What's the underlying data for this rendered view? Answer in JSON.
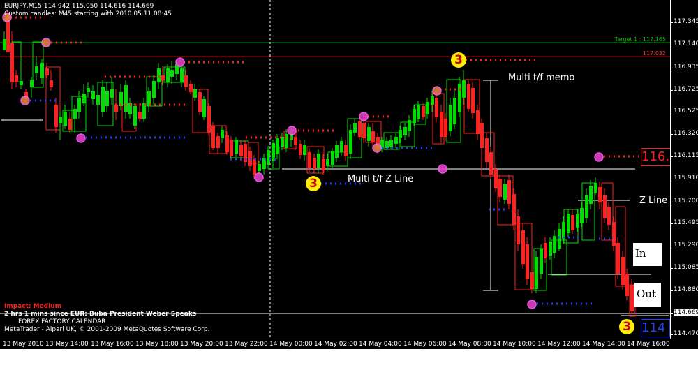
{
  "header": {
    "symbol_line": "EURJPY,M15  114.942 115.050 114.616 114.669",
    "custom_line": "Custom candles: M45 starting with 2010.05.11 08:45"
  },
  "price_axis": {
    "labels": [
      "117.345",
      "117.140",
      "116.935",
      "116.725",
      "116.525",
      "116.320",
      "116.115",
      "115.910",
      "115.700",
      "115.495",
      "115.290",
      "115.085",
      "114.880",
      "114.669",
      "114.470"
    ],
    "current_price": "114.669"
  },
  "time_axis": {
    "labels": [
      "13 May 2010",
      "13 May 14:00",
      "13 May 16:00",
      "13 May 18:00",
      "13 May 20:00",
      "13 May 22:00",
      "14 May 00:00",
      "14 May 02:00",
      "14 May 04:00",
      "14 May 06:00",
      "14 May 08:00",
      "14 May 10:00",
      "14 May 12:00",
      "14 May 14:00",
      "14 May 16:00"
    ]
  },
  "lines": {
    "target_label": "Target 1 : 117.165",
    "red_level_label": "117.032"
  },
  "annotations": {
    "multi_tf_memo": "Multi t/f memo",
    "multi_tf_zline": "Multi t/f Z Line",
    "z_line": "Z Line",
    "in_label": "In",
    "out_label": "Out",
    "marker_3": "3",
    "right_red_tag": "116.",
    "right_blue_tag": "114"
  },
  "footer": {
    "impact": "Impact: Medium",
    "news": "2 hrs 1 mins since EUR: Buba President Weber Speaks",
    "calendar": "FOREX FACTORY CALENDAR",
    "copyright": "MetaTrader - Alpari UK, © 2001-2009 MetaQuotes Software Corp."
  },
  "colors": {
    "background": "#000000",
    "bull_candle": "#00dd00",
    "bear_candle": "#ff2020",
    "target_line": "#00a000",
    "red_level": "#c00000",
    "dot_red": "#ff2020",
    "dot_blue": "#2040ff",
    "marker_pink": "#e040c0",
    "marker_orange": "#e08040"
  }
}
